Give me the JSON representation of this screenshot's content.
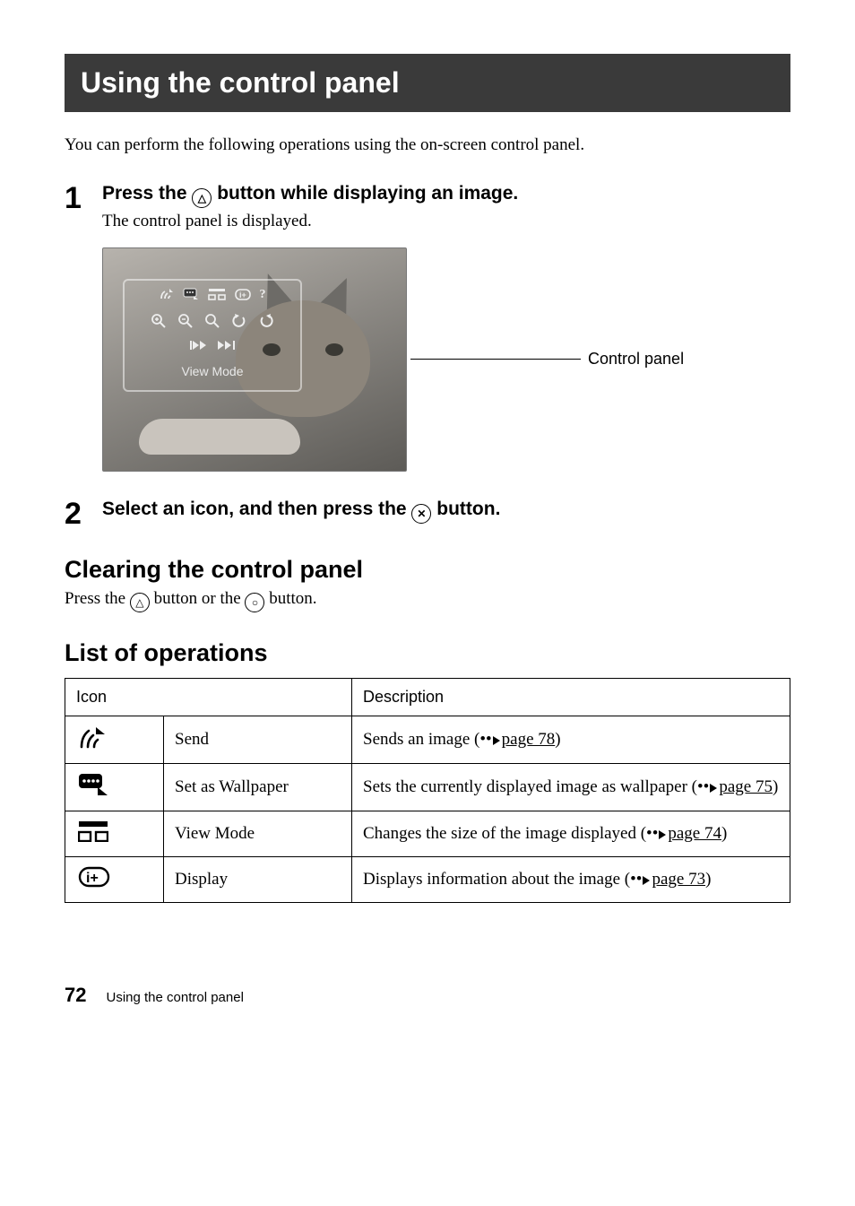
{
  "title": "Using the control panel",
  "intro": "You can perform the following operations using the on-screen control panel.",
  "step1": {
    "num": "1",
    "title_before": "Press the ",
    "button_glyph": "△",
    "title_after": " button while displaying an image.",
    "sub": "The control panel is displayed."
  },
  "figure": {
    "overlay_label": "View Mode",
    "callout": "Control panel"
  },
  "step2": {
    "num": "2",
    "title_before": "Select an icon, and then press the ",
    "button_glyph": "✕",
    "title_after": " button."
  },
  "clearing": {
    "heading": "Clearing the control panel",
    "text_before": "Press the ",
    "btn1": "△",
    "text_mid": " button or the ",
    "btn2": "○",
    "text_after": " button."
  },
  "ops_heading": "List of operations",
  "table": {
    "header_icon": "Icon",
    "header_desc": "Description",
    "rows": [
      {
        "name": "Send",
        "desc_before": "Sends an image (",
        "desc_ref": "page 78",
        "desc_after": ")"
      },
      {
        "name": "Set as Wallpaper",
        "desc_before": "Sets the currently displayed image as wallpaper (",
        "desc_ref": "page 75",
        "desc_after": ")"
      },
      {
        "name": "View Mode",
        "desc_before": "Changes the size of the image displayed (",
        "desc_ref": "page 74",
        "desc_after": ")"
      },
      {
        "name": "Display",
        "desc_before": "Displays information about the image (",
        "desc_ref": "page 73",
        "desc_after": ")"
      }
    ]
  },
  "footer": {
    "page": "72",
    "text": "Using the control panel"
  }
}
